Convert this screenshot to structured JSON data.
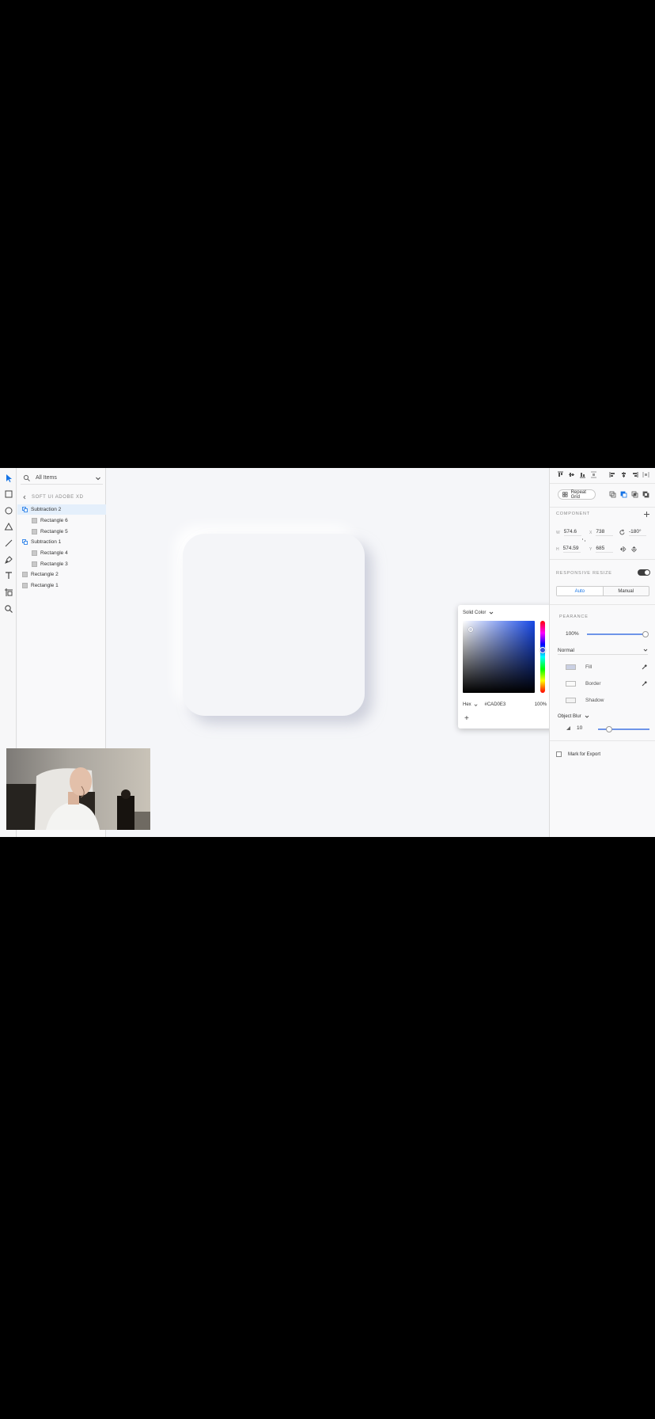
{
  "layers_panel": {
    "search_placeholder": "All Items",
    "artboard": "SOFT UI ADOBE XD",
    "items": [
      {
        "label": "Subtraction 2",
        "type": "group",
        "selected": true
      },
      {
        "label": "Rectangle 6",
        "type": "rect"
      },
      {
        "label": "Rectangle 5",
        "type": "rect"
      },
      {
        "label": "Subtraction 1",
        "type": "group"
      },
      {
        "label": "Rectangle 4",
        "type": "rect"
      },
      {
        "label": "Rectangle 3",
        "type": "rect"
      },
      {
        "label": "Rectangle 2",
        "type": "rect"
      },
      {
        "label": "Rectangle 1",
        "type": "rect"
      }
    ]
  },
  "color_picker": {
    "type": "Solid Color",
    "mode": "Hex",
    "hex": "#CAD0E3",
    "opacity": "100%",
    "add": "+"
  },
  "properties": {
    "repeat_grid": "Repeat Grid",
    "component_title": "COMPONENT",
    "w_label": "W",
    "w": "574.6",
    "x_label": "X",
    "x": "738",
    "rotation": "-180°",
    "h_label": "H",
    "h": "574.59",
    "y_label": "Y",
    "y": "685",
    "responsive_title": "RESPONSIVE RESIZE",
    "seg_auto": "Auto",
    "seg_manual": "Manual",
    "appearance_title": "PEARANCE",
    "opacity": "100%",
    "blend_mode": "Normal",
    "fill": "Fill",
    "border": "Border",
    "shadow": "Shadow",
    "effect": "Object Blur",
    "blur_value": "10",
    "mark_export": "Mark for Export"
  },
  "colors": {
    "accent": "#1473e6",
    "selection": "#e4effb",
    "fill_swatch": "#cad0e3",
    "canvas": "#f5f6f9"
  }
}
